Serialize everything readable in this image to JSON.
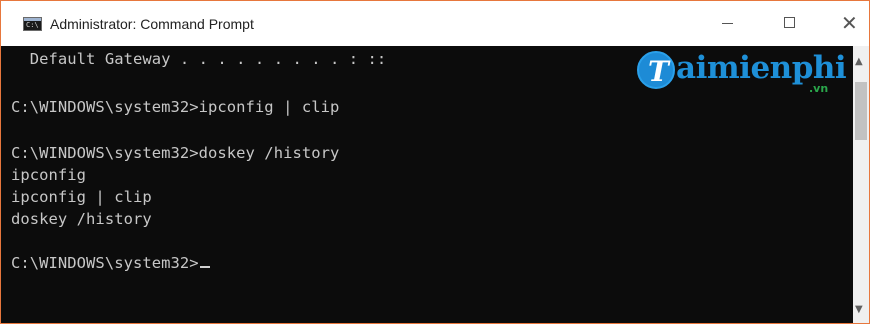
{
  "window": {
    "title": "Administrator: Command Prompt",
    "app_icon_text": "C:\\",
    "controls": {
      "minimize_icon": "minimize-icon",
      "maximize_icon": "maximize-icon",
      "close_glyph": "✕"
    }
  },
  "console": {
    "lines": [
      "  Default Gateway . . . . . . . . . : ::",
      "",
      "C:\\WINDOWS\\system32>ipconfig | clip",
      "",
      "C:\\WINDOWS\\system32>doskey /history",
      "ipconfig",
      "ipconfig | clip",
      "doskey /history",
      "",
      "C:\\WINDOWS\\system32>"
    ]
  },
  "scrollbar": {
    "up_arrow": "▲",
    "down_arrow": "▼"
  },
  "watermark": {
    "badge_letter": "T",
    "text": "aimienphi",
    "suffix": ".vn"
  },
  "colors": {
    "console_bg": "#0c0c0c",
    "console_text": "#c7c7c7",
    "window_border": "#e7773d",
    "watermark_blue": "#1e90d8",
    "watermark_green": "#2aa64b"
  }
}
